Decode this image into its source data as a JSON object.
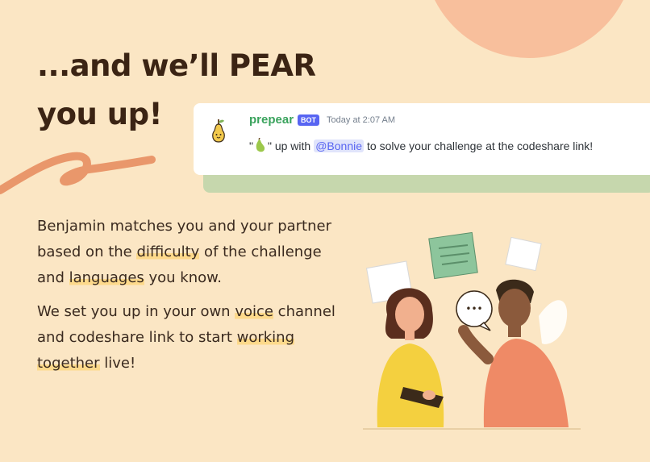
{
  "headline": {
    "line1": "...and we’ll PEAR",
    "line2": "you up!"
  },
  "message": {
    "bot_name": "prepear",
    "bot_tag": "BOT",
    "timestamp": "Today at 2:07 AM",
    "text_open_quote": "\"",
    "text_close_quote": "\" up with",
    "mention": "@Bonnie",
    "text_rest": "to solve your challenge at the codeshare link!"
  },
  "paragraph1": {
    "t1": "Benjamin matches you and your partner based on the ",
    "h1": "difficulty",
    "t2": " of the challenge and ",
    "h2": "languages",
    "t3": " you know."
  },
  "paragraph2": {
    "t1": "We set you up in your own ",
    "h1": "voice",
    "t2": " channel and codeshare link to start ",
    "h2": "working together",
    "t3": " live!"
  },
  "speech_bubble": "•••",
  "colors": {
    "background": "#fbe6c4",
    "sun": "#f8bf9c",
    "squiggle": "#e9976b",
    "card_shadow": "#c6d7ad",
    "bot_name": "#3aa35d",
    "bot_tag": "#5865f2",
    "highlight": "#fdd98b"
  },
  "icons": [
    "pear-icon",
    "pear-emoji-icon",
    "sticky-note-icon",
    "speech-bubble-icon"
  ]
}
